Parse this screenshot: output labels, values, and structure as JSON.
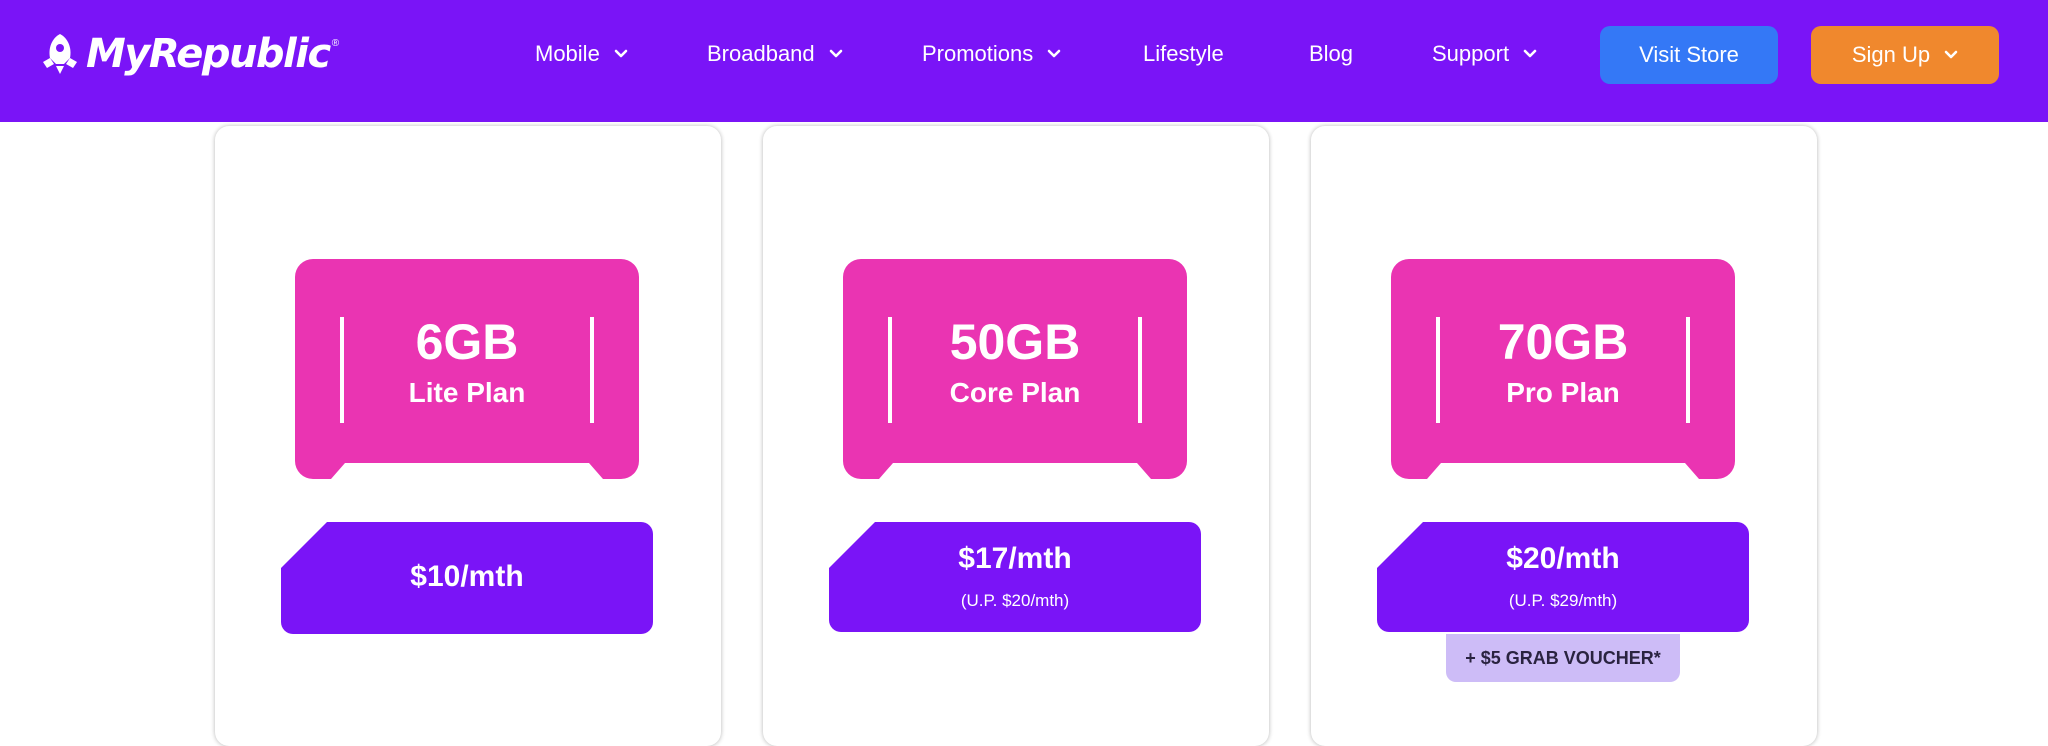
{
  "brand": {
    "name": "MyRepublic",
    "registered_mark": "®"
  },
  "nav": {
    "items": [
      {
        "label": "Mobile",
        "has_dropdown": true
      },
      {
        "label": "Broadband",
        "has_dropdown": true
      },
      {
        "label": "Promotions",
        "has_dropdown": true
      },
      {
        "label": "Lifestyle",
        "has_dropdown": false
      },
      {
        "label": "Blog",
        "has_dropdown": false
      },
      {
        "label": "Support",
        "has_dropdown": true
      }
    ],
    "visit_store_label": "Visit Store",
    "sign_up_label": "Sign Up"
  },
  "plans": [
    {
      "data": "6GB",
      "name": "Lite Plan",
      "price": "$10/mth",
      "usual_price": ""
    },
    {
      "data": "50GB",
      "name": "Core Plan",
      "price": "$17/mth",
      "usual_price": "(U.P. $20/mth)"
    },
    {
      "data": "70GB",
      "name": "Pro Plan",
      "price": "$20/mth",
      "usual_price": "(U.P. $29/mth)"
    }
  ],
  "voucher_label": "+ $5 GRAB VOUCHER*",
  "colors": {
    "nav_background": "#7a14f7",
    "visit_store_button": "#3478f6",
    "sign_up_button": "#f0882d",
    "sim_card": "#ea34b2",
    "price_tag": "#7a14f7",
    "voucher": "#cdbcf7"
  }
}
